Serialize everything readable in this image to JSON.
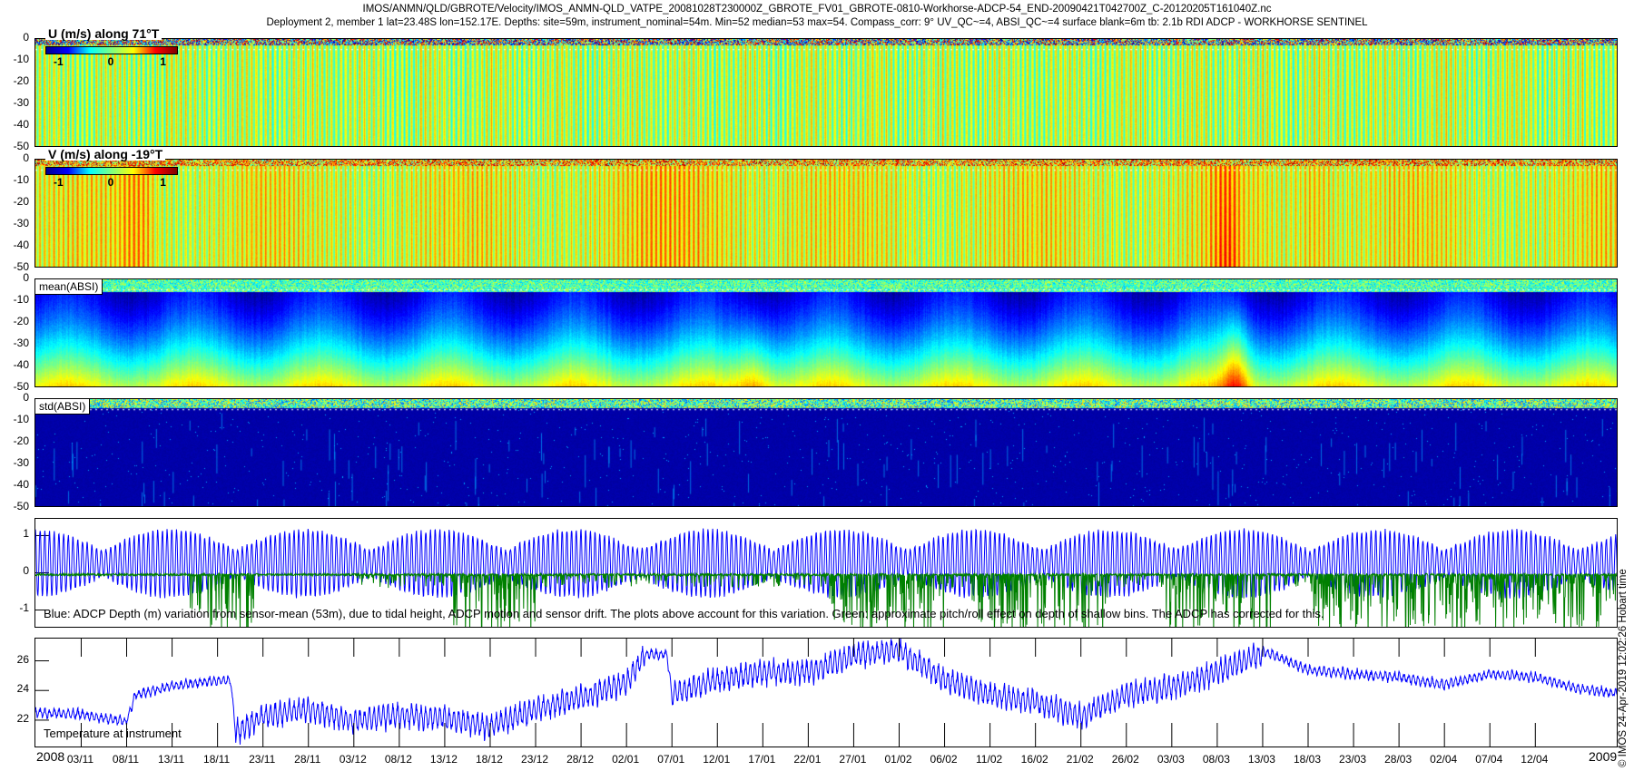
{
  "title": {
    "line1": "IMOS/ANMN/QLD/GBROTE/Velocity/IMOS_ANMN-QLD_VATPE_20081028T230000Z_GBROTE_FV01_GBROTE-0810-Workhorse-ADCP-54_END-20090421T042700Z_C-20120205T161040Z.nc",
    "line2": "Deployment 2, member 1 lat=23.48S lon=152.17E. Depths: site=59m, instrument_nominal=54m. Min=52 median=53 max=54. Compass_corr: 9° UV_QC~=4, ABSI_QC~=4 surface blank=6m tb: 2.1b RDI ADCP - WORKHORSE SENTINEL"
  },
  "credit": "© IMOS 24-Apr-2019 12:02:26 Hobart time",
  "time_axis": {
    "start_year": "2008",
    "end_year": "2009",
    "total_days": 174.2,
    "first_tick_day": 5.04,
    "tick_step_days": 5,
    "tick_labels": [
      "03/11",
      "08/11",
      "13/11",
      "18/11",
      "23/11",
      "28/11",
      "03/12",
      "08/12",
      "13/12",
      "18/12",
      "23/12",
      "28/12",
      "02/01",
      "07/01",
      "12/01",
      "17/01",
      "22/01",
      "27/01",
      "01/02",
      "06/02",
      "11/02",
      "16/02",
      "21/02",
      "26/02",
      "03/03",
      "08/03",
      "13/03",
      "18/03",
      "23/03",
      "28/03",
      "02/04",
      "07/04",
      "12/04"
    ]
  },
  "colorbar": {
    "colormap": "jet",
    "clim": [
      -1.25,
      1.25
    ],
    "ticks": [
      "-1",
      "0",
      "1"
    ]
  },
  "chart_data": [
    {
      "id": "u",
      "type": "heatmap",
      "title": "U (m/s) along 71°T",
      "ylim": [
        -50,
        0
      ],
      "yticks": [
        "0",
        "-10",
        "-20",
        "-30",
        "-40",
        "-50"
      ],
      "clim": [
        -1.25,
        1.25
      ],
      "colormap": "jet",
      "surface_blank_m": 6
    },
    {
      "id": "v",
      "type": "heatmap",
      "title": "V (m/s) along -19°T",
      "ylim": [
        -50,
        0
      ],
      "yticks": [
        "0",
        "-10",
        "-20",
        "-30",
        "-40",
        "-50"
      ],
      "clim": [
        -1.25,
        1.25
      ],
      "colormap": "jet",
      "surface_blank_m": 6
    },
    {
      "id": "mabsi",
      "type": "heatmap",
      "title": "mean(ABSI)",
      "ylim": [
        -50,
        0
      ],
      "yticks": [
        "0",
        "-10",
        "-20",
        "-30",
        "-40",
        "-50"
      ],
      "colormap": "jet"
    },
    {
      "id": "sabsi",
      "type": "heatmap",
      "title": "std(ABSI)",
      "ylim": [
        -50,
        0
      ],
      "yticks": [
        "0",
        "-10",
        "-20",
        "-30",
        "-40",
        "-50"
      ],
      "colormap": "jet"
    },
    {
      "id": "depth",
      "type": "line",
      "ylim": [
        -1.5,
        1.45
      ],
      "yticks": [
        "1",
        "0",
        "-1"
      ],
      "ytick_values": [
        1,
        0,
        -1
      ],
      "annotation": "Blue: ADCP Depth (m) variation from sensor-mean (53m), due to tidal height, ADCP motion and sensor drift. The plots above account for this variation. Green: approximate pitch/roll effect on depth of shallow bins. The ADCP has corrected for this.",
      "series": [
        {
          "name": "ADCP depth variation",
          "color": "#0000ff"
        },
        {
          "name": "pitch/roll effect",
          "color": "#008000"
        }
      ]
    },
    {
      "id": "temp",
      "type": "line",
      "ylim": [
        20.1,
        27.5
      ],
      "yticks": [
        "22",
        "24",
        "26"
      ],
      "ytick_values": [
        22,
        24,
        26
      ],
      "annotation": "Temperature at instrument",
      "series": [
        {
          "name": "Temperature",
          "color": "#0000ff",
          "days": [
            0,
            5,
            10,
            11,
            15,
            20,
            21.5,
            22,
            25,
            30,
            35,
            40,
            45,
            50,
            55,
            60,
            65,
            67,
            69.5,
            70,
            75,
            80,
            85,
            90,
            95,
            100,
            105,
            110,
            115,
            120,
            125,
            130,
            135,
            140,
            145,
            150,
            155,
            160,
            165,
            170,
            174
          ],
          "values": [
            22.6,
            22.5,
            22,
            23.8,
            24.4,
            24.8,
            24.8,
            21.4,
            22.5,
            23.0,
            22.2,
            22.6,
            22.4,
            21.8,
            23,
            23.8,
            24.8,
            26.6,
            26.5,
            24,
            25,
            25.5,
            25.5,
            26.6,
            27,
            25,
            24,
            23.5,
            22.5,
            24,
            24.5,
            25.5,
            26.8,
            25.5,
            25.2,
            25,
            24.5,
            25.2,
            25,
            24.2,
            23.9
          ]
        }
      ]
    }
  ]
}
